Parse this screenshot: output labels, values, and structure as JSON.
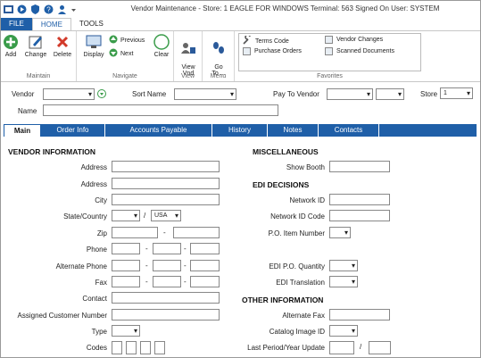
{
  "window": {
    "title": "Vendor Maintenance - Store: 1 EAGLE FOR WINDOWS Terminal: 563 Signed On User: SYSTEM"
  },
  "ribbon_tabs": {
    "file": "FILE",
    "home": "HOME",
    "tools": "TOOLS"
  },
  "ribbon": {
    "maintain": {
      "add": "Add",
      "change": "Change",
      "delete": "Delete",
      "label": "Maintain"
    },
    "navigate": {
      "display": "Display",
      "previous": "Previous",
      "next": "Next",
      "clear": "Clear",
      "label": "Navigate"
    },
    "view": {
      "view_vnd": "View\nVnd",
      "label": "View"
    },
    "menu": {
      "go_to": "Go\nTo ...",
      "label": "Menu"
    },
    "favorites": {
      "terms_code": "Terms Code",
      "purchase_orders": "Purchase Orders",
      "vendor_changes": "Vendor Changes",
      "scanned_documents": "Scanned Documents",
      "label": "Favorites"
    }
  },
  "header": {
    "vendor_label": "Vendor",
    "sort_name_label": "Sort Name",
    "pay_to_vendor_label": "Pay To Vendor",
    "store_label": "Store",
    "store_value": "1",
    "name_label": "Name"
  },
  "tabs": [
    "Main",
    "Order Info",
    "Accounts Payable",
    "History",
    "Notes",
    "Contacts"
  ],
  "vendor_info": {
    "heading": "VENDOR INFORMATION",
    "address1": "Address",
    "address2": "Address",
    "city": "City",
    "state_country": "State/Country",
    "country_value": "USA",
    "slash": "/",
    "zip": "Zip",
    "dash": "-",
    "phone": "Phone",
    "alt_phone": "Alternate Phone",
    "fax": "Fax",
    "contact": "Contact",
    "assigned_customer": "Assigned Customer Number",
    "type": "Type",
    "codes": "Codes"
  },
  "misc": {
    "heading": "MISCELLANEOUS",
    "show_booth": "Show Booth"
  },
  "edi": {
    "heading": "EDI DECISIONS",
    "network_id": "Network ID",
    "network_id_code": "Network ID Code",
    "po_item_number": "P.O. Item Number",
    "edi_po_qty": "EDI P.O. Quantity",
    "edi_translation": "EDI Translation"
  },
  "other": {
    "heading": "OTHER INFORMATION",
    "alternate_fax": "Alternate Fax",
    "catalog_image_id": "Catalog Image ID",
    "last_period": "Last Period/Year Update",
    "slash": "/"
  }
}
